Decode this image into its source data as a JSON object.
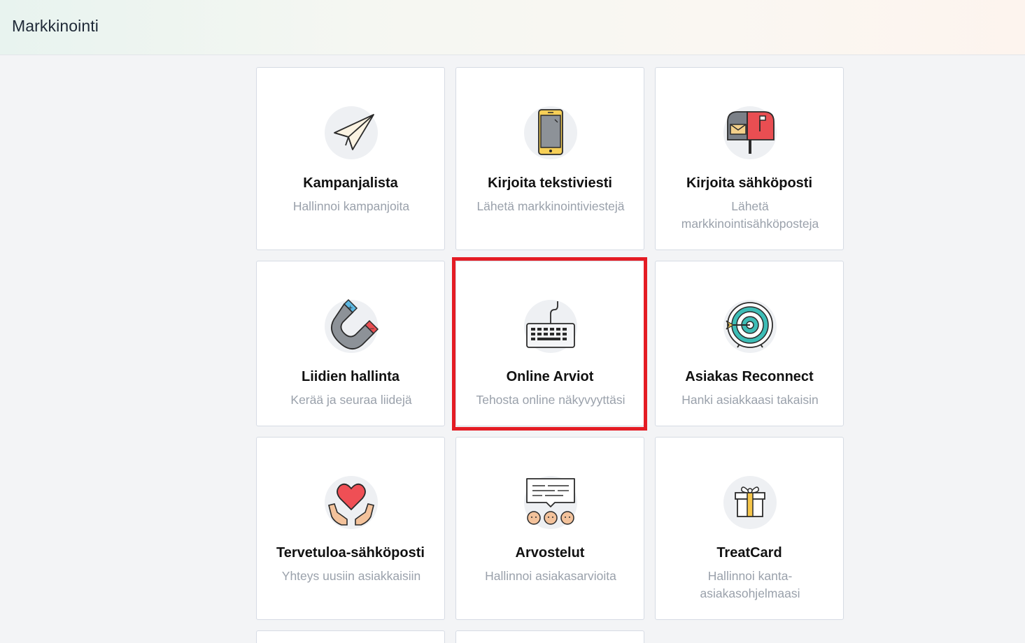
{
  "header": {
    "title": "Markkinointi"
  },
  "cards": [
    {
      "title": "Kampanjalista",
      "subtitle": "Hallinnoi kampanjoita",
      "icon": "paper-plane-icon"
    },
    {
      "title": "Kirjoita tekstiviesti",
      "subtitle": "Lähetä markkinointiviestejä",
      "icon": "smartphone-icon"
    },
    {
      "title": "Kirjoita sähköposti",
      "subtitle": "Lähetä markkinointisähköposteja",
      "icon": "mailbox-icon"
    },
    {
      "title": "Liidien hallinta",
      "subtitle": "Kerää ja seuraa liidejä",
      "icon": "magnet-icon"
    },
    {
      "title": "Online Arviot",
      "subtitle": "Tehosta online näkyvyyttäsi",
      "icon": "keyboard-icon"
    },
    {
      "title": "Asiakas Reconnect",
      "subtitle": "Hanki asiakkaasi takaisin",
      "icon": "target-icon"
    },
    {
      "title": "Tervetuloa-sähköposti",
      "subtitle": "Yhteys uusiin asiakkaisiin",
      "icon": "heart-hands-icon"
    },
    {
      "title": "Arvostelut",
      "subtitle": "Hallinnoi asiakasarvioita",
      "icon": "reviews-icon"
    },
    {
      "title": "TreatCard",
      "subtitle": "Hallinnoi kanta-asiakasohjelmaasi",
      "icon": "gift-icon"
    }
  ],
  "highlighted_card": "Online Arviot"
}
